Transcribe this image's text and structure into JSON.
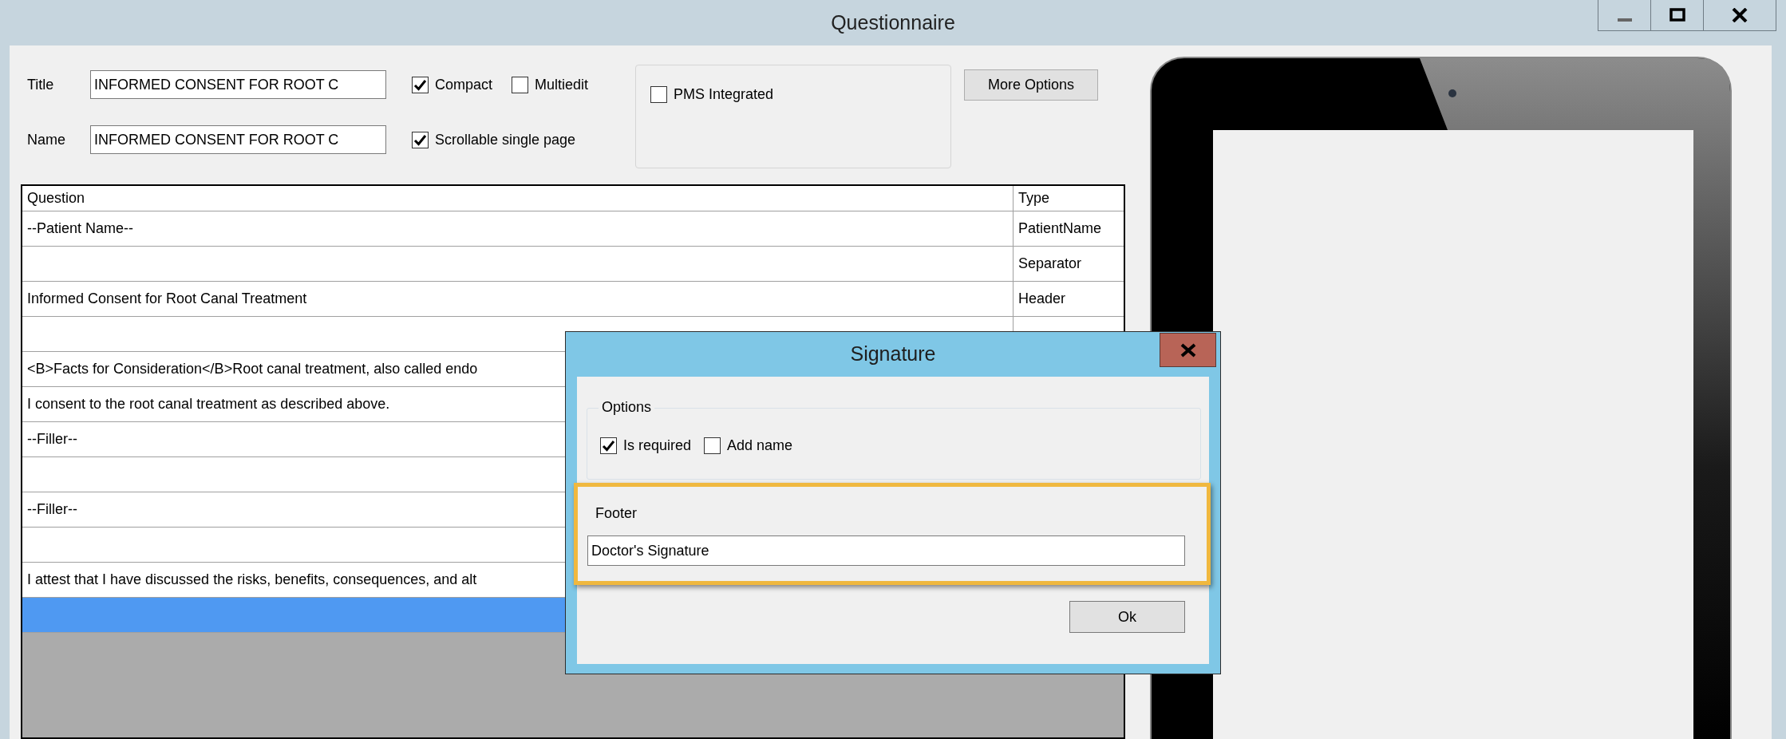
{
  "window": {
    "title": "Questionnaire"
  },
  "form": {
    "title_label": "Title",
    "title_value": "INFORMED CONSENT FOR ROOT C",
    "name_label": "Name",
    "name_value": "INFORMED CONSENT FOR ROOT C",
    "options": [
      {
        "label": "Compact",
        "checked": true
      },
      {
        "label": "Multiedit",
        "checked": false
      },
      {
        "label": "Scrollable single page",
        "checked": true
      }
    ],
    "pms": {
      "label": "PMS Integrated",
      "checked": false
    },
    "more_button": "More Options"
  },
  "table": {
    "columns": [
      "Question",
      "Type"
    ],
    "rows": [
      {
        "question": "--Patient Name--",
        "type": "PatientName",
        "selected": false
      },
      {
        "type": "Separator",
        "selected": false
      },
      {
        "question": "Informed Consent for Root Canal Treatment",
        "type": "Header",
        "selected": false
      },
      {
        "selected": false
      },
      {
        "question": "<B>Facts for Consideration</B>Root canal treatment, also called endo",
        "selected": false
      },
      {
        "question": "I consent to the root canal treatment as described above.",
        "selected": false
      },
      {
        "question": "--Filler--",
        "selected": false
      },
      {
        "selected": false
      },
      {
        "question": "--Filler--",
        "selected": false
      },
      {
        "selected": false
      },
      {
        "question": "I attest that I have discussed the risks, benefits, consequences, and alt",
        "selected": false
      },
      {
        "selected": true
      }
    ]
  },
  "dialog": {
    "title": "Signature",
    "options_legend": "Options",
    "checkboxes": [
      {
        "label": "Is required",
        "checked": true
      },
      {
        "label": "Add name",
        "checked": false
      }
    ],
    "footer_label": "Footer",
    "footer_value": "Doctor's Signature",
    "ok_button": "Ok"
  }
}
